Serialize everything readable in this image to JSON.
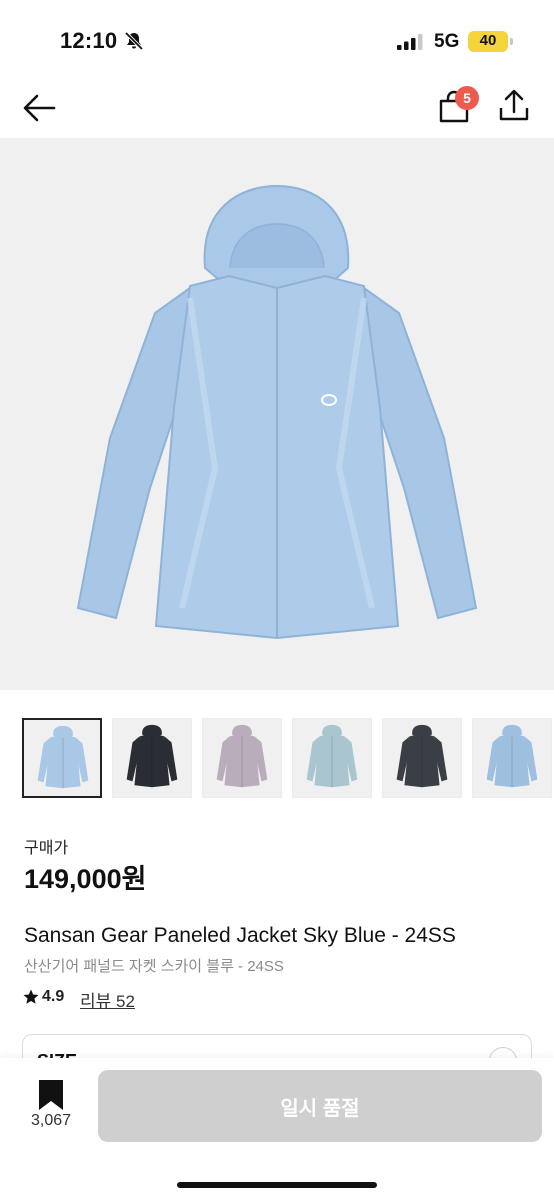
{
  "status_bar": {
    "time": "12:10",
    "network": "5G",
    "battery": "40"
  },
  "nav": {
    "cart_count": "5"
  },
  "gallery": {
    "thumbnails": [
      {
        "name": "Sky Blue",
        "color": "#a9c7e6",
        "active": true
      },
      {
        "name": "Black",
        "color": "#2a2e34",
        "active": false
      },
      {
        "name": "Lavender",
        "color": "#b9adbc",
        "active": false
      },
      {
        "name": "Sage",
        "color": "#a9c5cf",
        "active": false
      },
      {
        "name": "Black Shell",
        "color": "#3a3f46",
        "active": false
      },
      {
        "name": "Blue",
        "color": "#9fbfe0",
        "active": false
      }
    ],
    "hero_color": "#a9c7e6"
  },
  "product": {
    "price_label": "구매가",
    "price": "149,000원",
    "title_en": "Sansan Gear Paneled Jacket Sky Blue - 24SS",
    "title_ko": "산산기어 패널드 자켓 스카이 블루 - 24SS",
    "rating": "4.9",
    "review_link": "리뷰 52"
  },
  "size_selector": {
    "label": "SIZE"
  },
  "bottom_bar": {
    "bookmark_count": "3,067",
    "primary_button": "일시 품절"
  },
  "colors": {
    "badge": "#ef5a4e",
    "battery": "#f5d43a",
    "disabled_button": "#cfcfcf"
  }
}
